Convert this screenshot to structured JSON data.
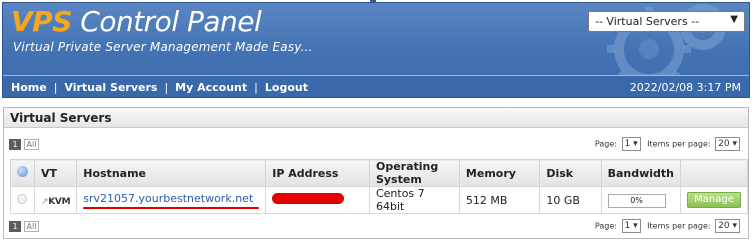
{
  "header": {
    "logo_accent": "VPS",
    "logo_text": "Control Panel",
    "tagline": "Virtual Private Server Management Made Easy...",
    "server_select": "-- Virtual Servers --",
    "nav": [
      "Home",
      "Virtual Servers",
      "My Account",
      "Logout"
    ],
    "datetime": "2022/02/08 3:17 PM"
  },
  "panel": {
    "title": "Virtual Servers",
    "pager": {
      "current_page": "1",
      "all_label": "All",
      "page_label": "Page:",
      "page_value": "1",
      "per_page_label": "Items per page:",
      "per_page_value": "20"
    },
    "table": {
      "columns": [
        "VT",
        "Hostname",
        "IP Address",
        "Operating System",
        "Memory",
        "Disk",
        "Bandwidth"
      ],
      "rows": [
        {
          "vt": "KVM",
          "hostname": "srv21057.yourbestnetwork.net",
          "ip": "",
          "os": "Centos 7 64bit",
          "memory": "512 MB",
          "disk": "10 GB",
          "bandwidth": "0%",
          "bandwidth_fraction": 0,
          "action": "Manage"
        }
      ]
    }
  },
  "colors": {
    "header_blue": "#4373b4",
    "logo_accent": "#f4a81e",
    "link": "#2a5caa",
    "manage_green": "#8cc152",
    "redaction": "#e50000"
  },
  "icons": [
    "gear-icon",
    "chevron-down-icon",
    "help-icon",
    "kvm-icon"
  ]
}
